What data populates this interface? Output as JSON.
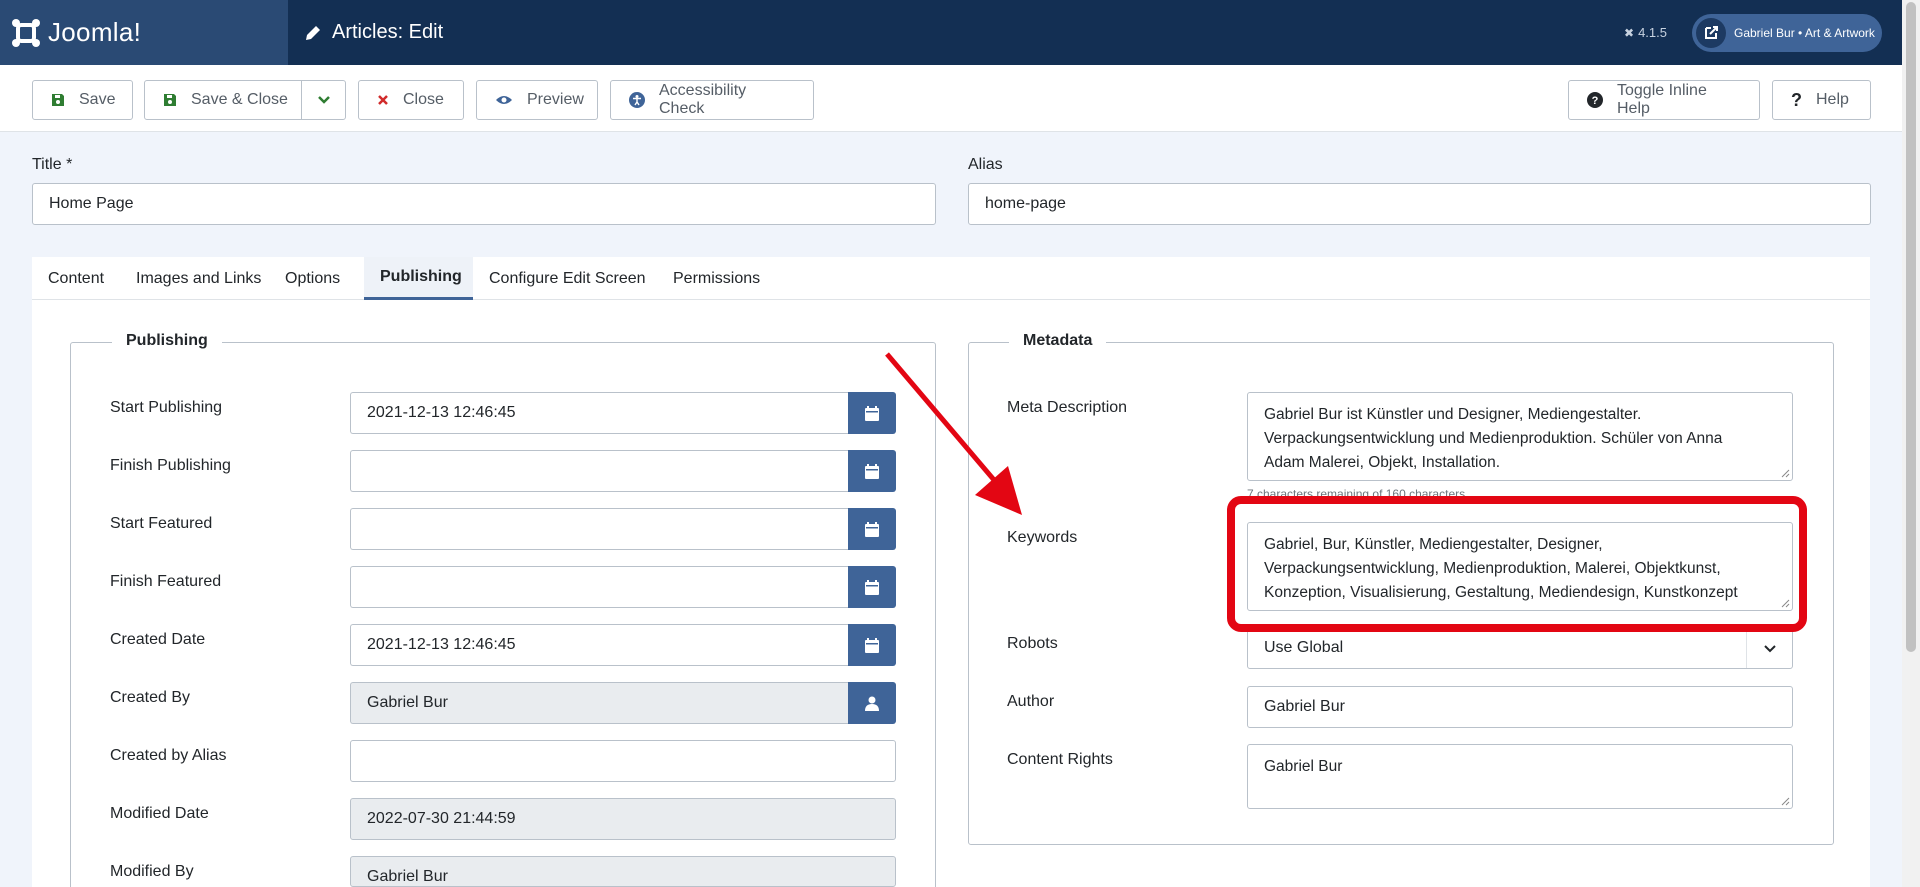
{
  "header": {
    "logo_text": "Joomla!",
    "page_title": "Articles: Edit",
    "version": "4.1.5",
    "user_label": "Gabriel Bur • Art & Artwork"
  },
  "toolbar": {
    "save": "Save",
    "save_close": "Save & Close",
    "close": "Close",
    "preview": "Preview",
    "accessibility": "Accessibility Check",
    "toggle_help": "Toggle Inline Help",
    "help": "Help"
  },
  "form": {
    "title_label": "Title *",
    "title_value": "Home Page",
    "alias_label": "Alias",
    "alias_value": "home-page"
  },
  "tabs": [
    "Content",
    "Images and Links",
    "Options",
    "Publishing",
    "Configure Edit Screen",
    "Permissions"
  ],
  "active_tab": "Publishing",
  "publishing": {
    "legend": "Publishing",
    "start_publishing": {
      "label": "Start Publishing",
      "value": "2021-12-13 12:46:45"
    },
    "finish_publishing": {
      "label": "Finish Publishing",
      "value": ""
    },
    "start_featured": {
      "label": "Start Featured",
      "value": ""
    },
    "finish_featured": {
      "label": "Finish Featured",
      "value": ""
    },
    "created_date": {
      "label": "Created Date",
      "value": "2021-12-13 12:46:45"
    },
    "created_by": {
      "label": "Created By",
      "value": "Gabriel Bur"
    },
    "created_by_alias": {
      "label": "Created by Alias",
      "value": ""
    },
    "modified_date": {
      "label": "Modified Date",
      "value": "2022-07-30 21:44:59"
    },
    "modified_by": {
      "label": "Modified By",
      "value": "Gabriel Bur"
    }
  },
  "metadata": {
    "legend": "Metadata",
    "meta_description": {
      "label": "Meta Description",
      "line1": "Gabriel Bur ist Künstler und Designer, Mediengestalter.",
      "line2": "Verpackungsentwicklung und Medienproduktion. Schüler von Anna",
      "line3": "Adam Malerei, Objekt, Installation.",
      "hint": "7 characters remaining of 160 characters."
    },
    "keywords": {
      "label": "Keywords",
      "line1": "Gabriel, Bur, Künstler, Mediengestalter, Designer,",
      "line2": "Verpackungsentwicklung, Medienproduktion, Malerei, Objektkunst,",
      "line3": "Konzeption, Visualisierung, Gestaltung, Mediendesign, Kunstkonzept"
    },
    "robots": {
      "label": "Robots",
      "value": "Use Global"
    },
    "author": {
      "label": "Author",
      "value": "Gabriel Bur"
    },
    "content_rights": {
      "label": "Content Rights",
      "value": "Gabriel Bur"
    }
  },
  "colors": {
    "header": "#132f53",
    "accent": "#3f6498",
    "highlight": "#e30613"
  }
}
